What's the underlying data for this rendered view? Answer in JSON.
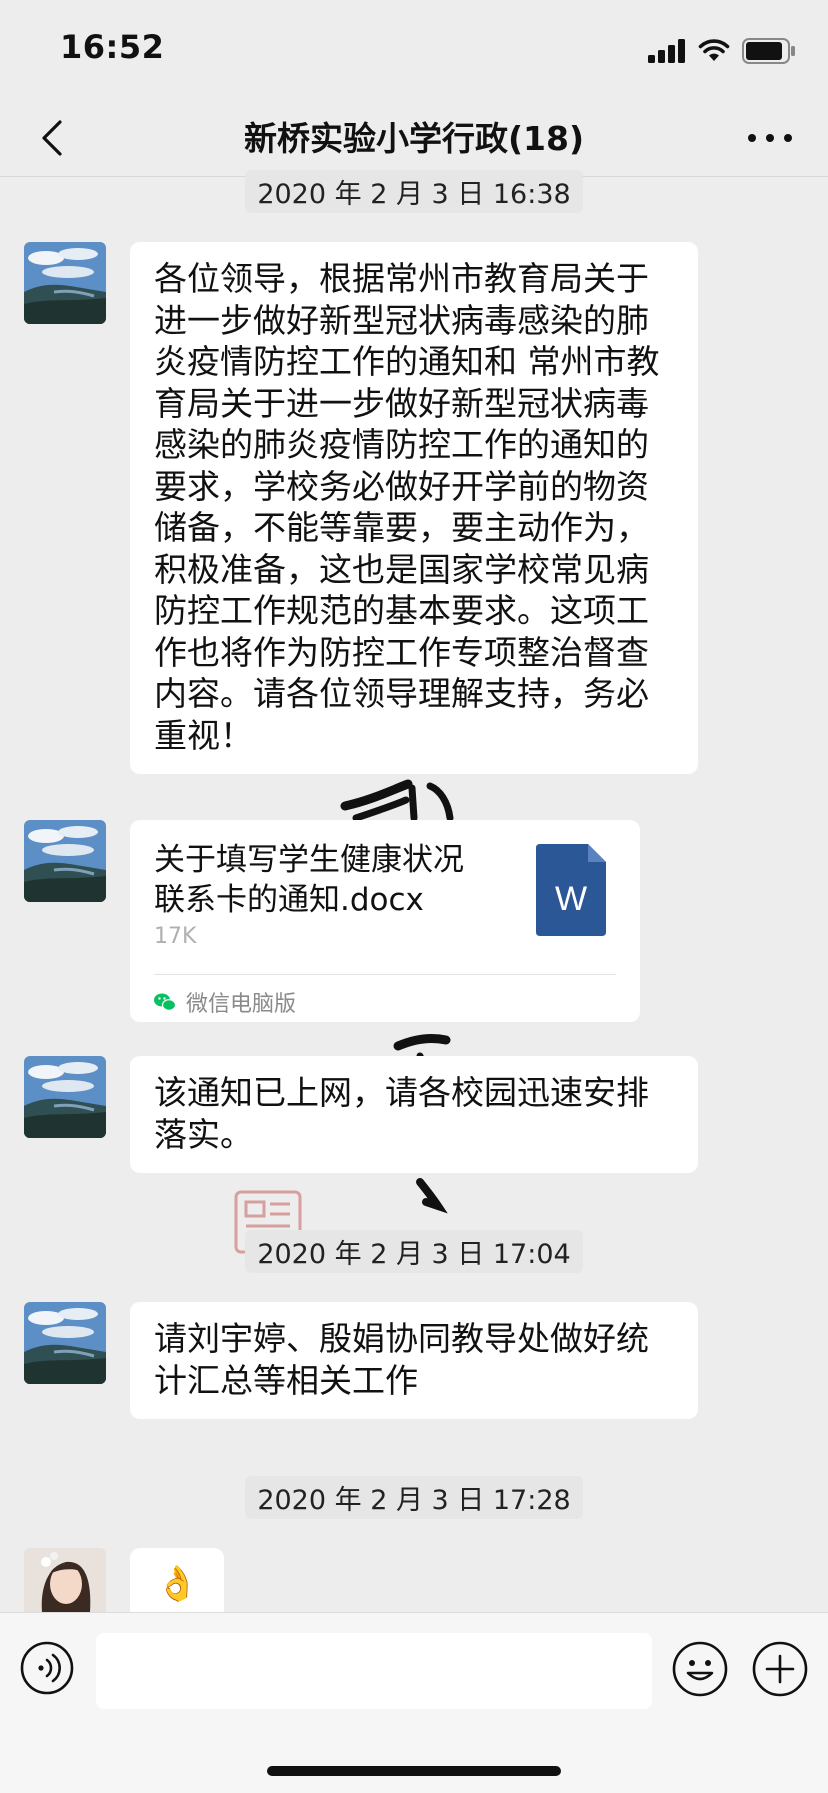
{
  "status_bar": {
    "time": "16:52"
  },
  "header": {
    "title": "新桥实验小学行政(18)"
  },
  "messages": [
    {
      "type": "timestamp",
      "text": "2020 年 2 月 3 日 16:38"
    },
    {
      "type": "text",
      "text": "各位领导，根据常州市教育局关于进一步做好新型冠状病毒感染的肺炎疫情防控工作的通知和  常州市教育局关于进一步做好新型冠状病毒感染的肺炎疫情防控工作的通知的要求，学校务必做好开学前的物资储备，不能等靠要，要主动作为，积极准备，这也是国家学校常见病防控工作规范的基本要求。这项工作也将作为防控工作专项整治督查内容。请各位领导理解支持，务必重视！"
    },
    {
      "type": "file",
      "name": "关于填写学生健康状况联系卡的通知.docx",
      "size": "17K",
      "icon_letter": "W",
      "source": "微信电脑版"
    },
    {
      "type": "text",
      "text": "该通知已上网，请各校园迅速安排落实。"
    },
    {
      "type": "timestamp",
      "text": "2020 年 2 月 3 日 17:04"
    },
    {
      "type": "text",
      "text": "请刘宇婷、殷娟协同教导处做好统计汇总等相关工作"
    },
    {
      "type": "timestamp",
      "text": "2020 年 2 月 3 日 17:28"
    },
    {
      "type": "emoji",
      "text": "👌"
    }
  ],
  "input": {
    "value": "",
    "placeholder": ""
  },
  "colors": {
    "background": "#ededed",
    "bubble": "#ffffff",
    "word_icon": "#2b5797",
    "wechat_green": "#07c160"
  }
}
